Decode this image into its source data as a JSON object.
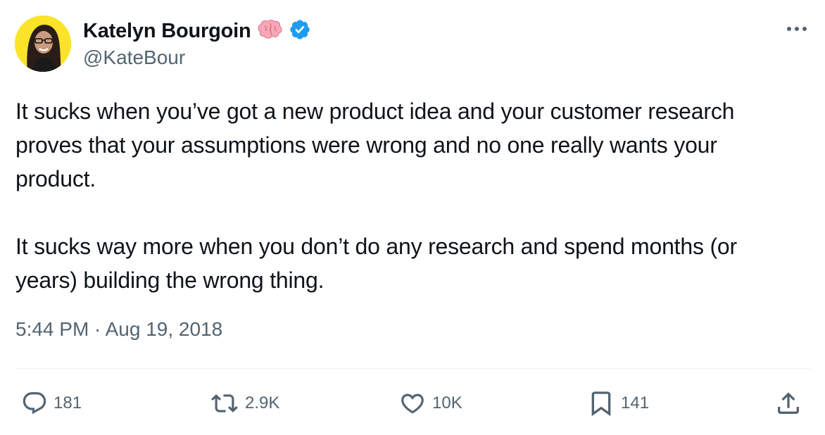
{
  "user": {
    "display_name": "Katelyn Bourgoin",
    "handle": "@KateBour",
    "name_emoji_icon": "brain-emoji-icon",
    "verified_icon": "verified-badge-icon"
  },
  "tweet": {
    "paragraph1": [
      "It sucks when you’ve got a new product idea and your customer research",
      "proves that your assumptions were wrong and no one really wants your",
      "product."
    ],
    "paragraph2": [
      "It sucks way more when you don’t do any research and spend months (or",
      "years) building the wrong thing."
    ],
    "timestamp": "5:44 PM · Aug 19, 2018"
  },
  "actions": {
    "replies": "181",
    "retweets": "2.9K",
    "likes": "10K",
    "bookmarks": "141"
  },
  "colors": {
    "text": "#0f1419",
    "secondary": "#536471",
    "verified": "#1d9bf0",
    "avatar_bg": "#fbe32a"
  }
}
